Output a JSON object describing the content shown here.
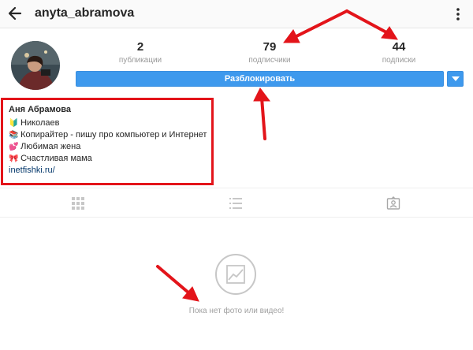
{
  "header": {
    "back_icon": "arrow-left-icon",
    "username": "anyta_abramova",
    "more_icon": "vertical-dots-icon"
  },
  "profile": {
    "avatar_icon": "profile-photo",
    "stats": {
      "posts": {
        "value": "2",
        "label": "публикации"
      },
      "followers": {
        "value": "79",
        "label": "подписчики"
      },
      "following": {
        "value": "44",
        "label": "подписки"
      }
    },
    "unblock_label": "Разблокировать",
    "dropdown_icon": "caret-down-icon"
  },
  "bio": {
    "name": "Аня Абрамова",
    "lines": [
      {
        "emoji": "🔰",
        "text": "Николаев"
      },
      {
        "emoji": "📚",
        "text": "Копирайтер - пишу про компьютер и Интернет"
      },
      {
        "emoji": "💕",
        "text": "Любимая жена"
      },
      {
        "emoji": "🎀",
        "text": "Счастливая мама"
      }
    ],
    "link": "inetfishki.ru/"
  },
  "tabs": [
    {
      "icon": "grid-icon"
    },
    {
      "icon": "list-icon"
    },
    {
      "icon": "tagged-photos-icon"
    }
  ],
  "empty_state": {
    "icon": "photo-icon",
    "text": "Пока нет фото или видео!"
  },
  "annotation_color": "#e3141a",
  "accent_color": "#3e99ed"
}
